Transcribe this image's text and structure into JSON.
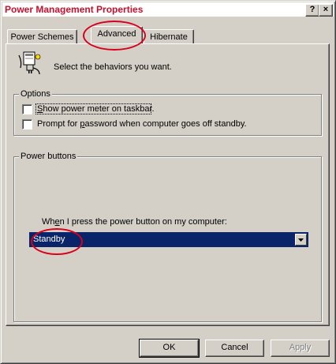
{
  "window": {
    "title": "Power Management Properties",
    "help_button": "?",
    "close_button": "×"
  },
  "tabs": [
    {
      "label": "Power Schemes",
      "active": false
    },
    {
      "label": "Advanced",
      "active": true
    },
    {
      "label": "Hibernate",
      "active": false
    }
  ],
  "header": {
    "icon": "power-plug-icon",
    "text": "Select the behaviors you want."
  },
  "options": {
    "label": "Options",
    "items": [
      {
        "label_pre": "",
        "label_u": "S",
        "label_post": "how power meter on taskbar.",
        "checked": false
      },
      {
        "label_pre": "Prompt for ",
        "label_u": "p",
        "label_post": "assword when computer goes off standby.",
        "checked": false
      }
    ]
  },
  "power_buttons": {
    "label": "Power buttons",
    "prompt_pre": "Wh",
    "prompt_u": "e",
    "prompt_post": "n I press the power button on my computer:",
    "selected": "Standby"
  },
  "buttons": {
    "ok": "OK",
    "cancel": "Cancel",
    "apply": "Apply"
  },
  "colors": {
    "title_text": "#c8102e",
    "highlight": "#0a246a",
    "annotation": "#d9001b",
    "face": "#d4d0c8"
  }
}
